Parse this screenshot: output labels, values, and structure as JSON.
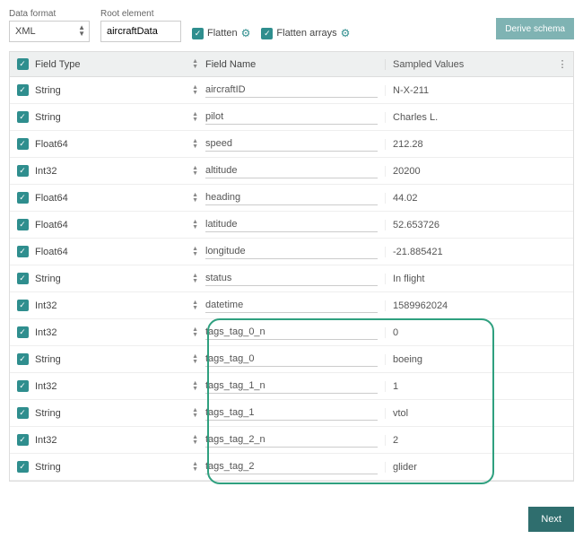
{
  "controls": {
    "dataFormatLabel": "Data format",
    "dataFormatValue": "XML",
    "rootElementLabel": "Root element",
    "rootElementValue": "aircraftData",
    "flattenLabel": "Flatten",
    "flattenArraysLabel": "Flatten arrays",
    "deriveSchemaLabel": "Derive schema"
  },
  "headers": {
    "fieldType": "Field Type",
    "fieldName": "Field Name",
    "sampledValues": "Sampled Values"
  },
  "rows": [
    {
      "type": "String",
      "name": "aircraftID",
      "value": "N-X-211"
    },
    {
      "type": "String",
      "name": "pilot",
      "value": "Charles L."
    },
    {
      "type": "Float64",
      "name": "speed",
      "value": "212.28"
    },
    {
      "type": "Int32",
      "name": "altitude",
      "value": "20200"
    },
    {
      "type": "Float64",
      "name": "heading",
      "value": "44.02"
    },
    {
      "type": "Float64",
      "name": "latitude",
      "value": "52.653726"
    },
    {
      "type": "Float64",
      "name": "longitude",
      "value": "-21.885421"
    },
    {
      "type": "String",
      "name": "status",
      "value": "In flight"
    },
    {
      "type": "Int32",
      "name": "datetime",
      "value": "1589962024"
    },
    {
      "type": "Int32",
      "name": "tags_tag_0_n",
      "value": "0"
    },
    {
      "type": "String",
      "name": "tags_tag_0",
      "value": "boeing"
    },
    {
      "type": "Int32",
      "name": "tags_tag_1_n",
      "value": "1"
    },
    {
      "type": "String",
      "name": "tags_tag_1",
      "value": "vtol"
    },
    {
      "type": "Int32",
      "name": "tags_tag_2_n",
      "value": "2"
    },
    {
      "type": "String",
      "name": "tags_tag_2",
      "value": "glider"
    }
  ],
  "footer": {
    "nextLabel": "Next"
  }
}
